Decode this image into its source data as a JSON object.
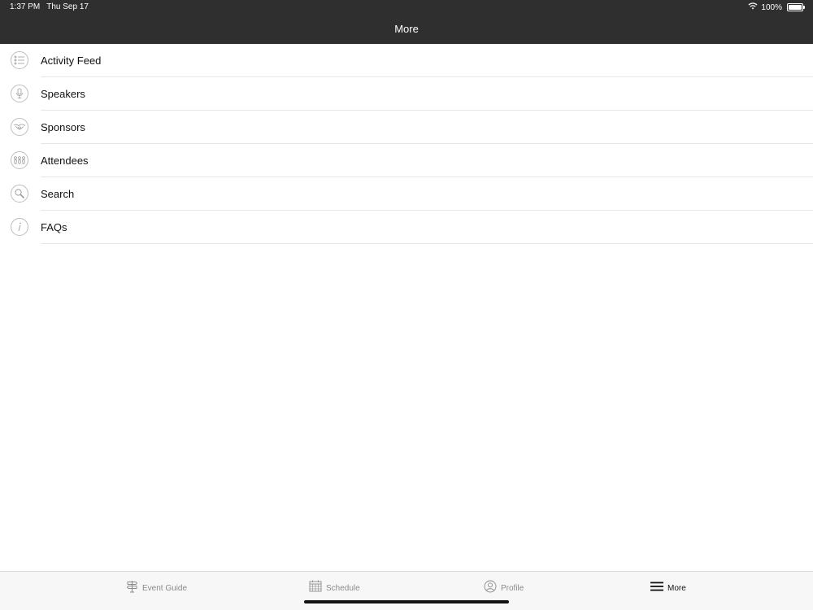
{
  "status_bar": {
    "time": "1:37 PM",
    "date": "Thu Sep 17",
    "battery_percent": "100%",
    "wifi_icon": "wifi-icon",
    "battery_icon": "battery-icon"
  },
  "header": {
    "title": "More"
  },
  "menu": {
    "items": [
      {
        "label": "Activity Feed",
        "icon": "activity-feed-icon"
      },
      {
        "label": "Speakers",
        "icon": "microphone-icon"
      },
      {
        "label": "Sponsors",
        "icon": "handshake-icon"
      },
      {
        "label": "Attendees",
        "icon": "people-icon"
      },
      {
        "label": "Search",
        "icon": "search-icon"
      },
      {
        "label": "FAQs",
        "icon": "info-icon"
      }
    ]
  },
  "tabbar": {
    "tabs": [
      {
        "label": "Event Guide",
        "icon": "signpost-icon",
        "active": false
      },
      {
        "label": "Schedule",
        "icon": "calendar-icon",
        "active": false
      },
      {
        "label": "Profile",
        "icon": "profile-icon",
        "active": false
      },
      {
        "label": "More",
        "icon": "hamburger-icon",
        "active": true
      }
    ]
  },
  "colors": {
    "header_bg": "#2f2f2f",
    "divider": "#e6e6e6",
    "tab_inactive": "#8a8a8a",
    "tab_active": "#111111"
  }
}
